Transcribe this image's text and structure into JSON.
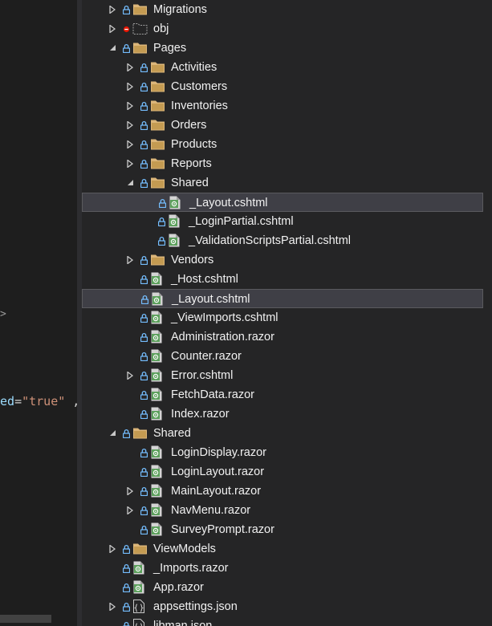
{
  "editor": {
    "chevron": ">",
    "code_attr": "ed",
    "code_eq": "=",
    "code_str": "\"true\"",
    "code_tail": " ,"
  },
  "tree": [
    {
      "label": "Migrations",
      "icon": "folder-icon",
      "badge": "lock",
      "expander": "collapsed",
      "depth": 0
    },
    {
      "label": "obj",
      "icon": "folder-hidden-icon",
      "badge": "excluded",
      "expander": "collapsed",
      "depth": 0
    },
    {
      "label": "Pages",
      "icon": "folder-icon",
      "badge": "lock",
      "expander": "expanded",
      "depth": 0
    },
    {
      "label": "Activities",
      "icon": "folder-icon",
      "badge": "lock",
      "expander": "collapsed",
      "depth": 1
    },
    {
      "label": "Customers",
      "icon": "folder-icon",
      "badge": "lock",
      "expander": "collapsed",
      "depth": 1
    },
    {
      "label": "Inventories",
      "icon": "folder-icon",
      "badge": "lock",
      "expander": "collapsed",
      "depth": 1
    },
    {
      "label": "Orders",
      "icon": "folder-icon",
      "badge": "lock",
      "expander": "collapsed",
      "depth": 1
    },
    {
      "label": "Products",
      "icon": "folder-icon",
      "badge": "lock",
      "expander": "collapsed",
      "depth": 1
    },
    {
      "label": "Reports",
      "icon": "folder-icon",
      "badge": "lock",
      "expander": "collapsed",
      "depth": 1
    },
    {
      "label": "Shared",
      "icon": "folder-icon",
      "badge": "lock",
      "expander": "expanded",
      "depth": 1
    },
    {
      "label": "_Layout.cshtml",
      "icon": "razor-file-icon",
      "badge": "lock",
      "expander": "none",
      "depth": 2,
      "selected": true
    },
    {
      "label": "_LoginPartial.cshtml",
      "icon": "razor-file-icon",
      "badge": "lock",
      "expander": "none",
      "depth": 2
    },
    {
      "label": "_ValidationScriptsPartial.cshtml",
      "icon": "razor-file-icon",
      "badge": "lock",
      "expander": "none",
      "depth": 2
    },
    {
      "label": "Vendors",
      "icon": "folder-icon",
      "badge": "lock",
      "expander": "collapsed",
      "depth": 1
    },
    {
      "label": "_Host.cshtml",
      "icon": "razor-file-icon",
      "badge": "lock",
      "expander": "none",
      "depth": 1
    },
    {
      "label": "_Layout.cshtml",
      "icon": "razor-file-icon",
      "badge": "lock",
      "expander": "none",
      "depth": 1,
      "selected": true
    },
    {
      "label": "_ViewImports.cshtml",
      "icon": "razor-file-icon",
      "badge": "lock",
      "expander": "none",
      "depth": 1
    },
    {
      "label": "Administration.razor",
      "icon": "razor-file-icon",
      "badge": "lock",
      "expander": "none",
      "depth": 1
    },
    {
      "label": "Counter.razor",
      "icon": "razor-file-icon",
      "badge": "lock",
      "expander": "none",
      "depth": 1
    },
    {
      "label": "Error.cshtml",
      "icon": "razor-file-icon",
      "badge": "lock",
      "expander": "collapsed",
      "depth": 1
    },
    {
      "label": "FetchData.razor",
      "icon": "razor-file-icon",
      "badge": "lock",
      "expander": "none",
      "depth": 1
    },
    {
      "label": "Index.razor",
      "icon": "razor-file-icon",
      "badge": "lock",
      "expander": "none",
      "depth": 1
    },
    {
      "label": "Shared",
      "icon": "folder-icon",
      "badge": "lock",
      "expander": "expanded",
      "depth": 0
    },
    {
      "label": "LoginDisplay.razor",
      "icon": "razor-file-icon",
      "badge": "lock",
      "expander": "none",
      "depth": 1
    },
    {
      "label": "LoginLayout.razor",
      "icon": "razor-file-icon",
      "badge": "lock",
      "expander": "none",
      "depth": 1
    },
    {
      "label": "MainLayout.razor",
      "icon": "razor-file-icon",
      "badge": "lock",
      "expander": "collapsed",
      "depth": 1
    },
    {
      "label": "NavMenu.razor",
      "icon": "razor-file-icon",
      "badge": "lock",
      "expander": "collapsed",
      "depth": 1
    },
    {
      "label": "SurveyPrompt.razor",
      "icon": "razor-file-icon",
      "badge": "lock",
      "expander": "none",
      "depth": 1
    },
    {
      "label": "ViewModels",
      "icon": "folder-icon",
      "badge": "lock",
      "expander": "collapsed",
      "depth": 0
    },
    {
      "label": "_Imports.razor",
      "icon": "razor-file-icon",
      "badge": "lock",
      "expander": "none",
      "depth": 0
    },
    {
      "label": "App.razor",
      "icon": "razor-file-icon",
      "badge": "lock",
      "expander": "none",
      "depth": 0
    },
    {
      "label": "appsettings.json",
      "icon": "json-file-icon",
      "badge": "lock",
      "expander": "collapsed",
      "depth": 0
    },
    {
      "label": "libman.json",
      "icon": "json-file-icon",
      "badge": "lock",
      "expander": "none",
      "depth": 0
    }
  ],
  "colors": {
    "panel_bg": "#252526",
    "editor_bg": "#1e1e1e",
    "selected_bg": "#3f3f46",
    "selected_border": "#5a5a5e",
    "folder": "#dcb67a",
    "lock": "#75beff",
    "excluded": "#e51400",
    "razor_green": "#5ca05c",
    "text": "#f1f1f1"
  }
}
